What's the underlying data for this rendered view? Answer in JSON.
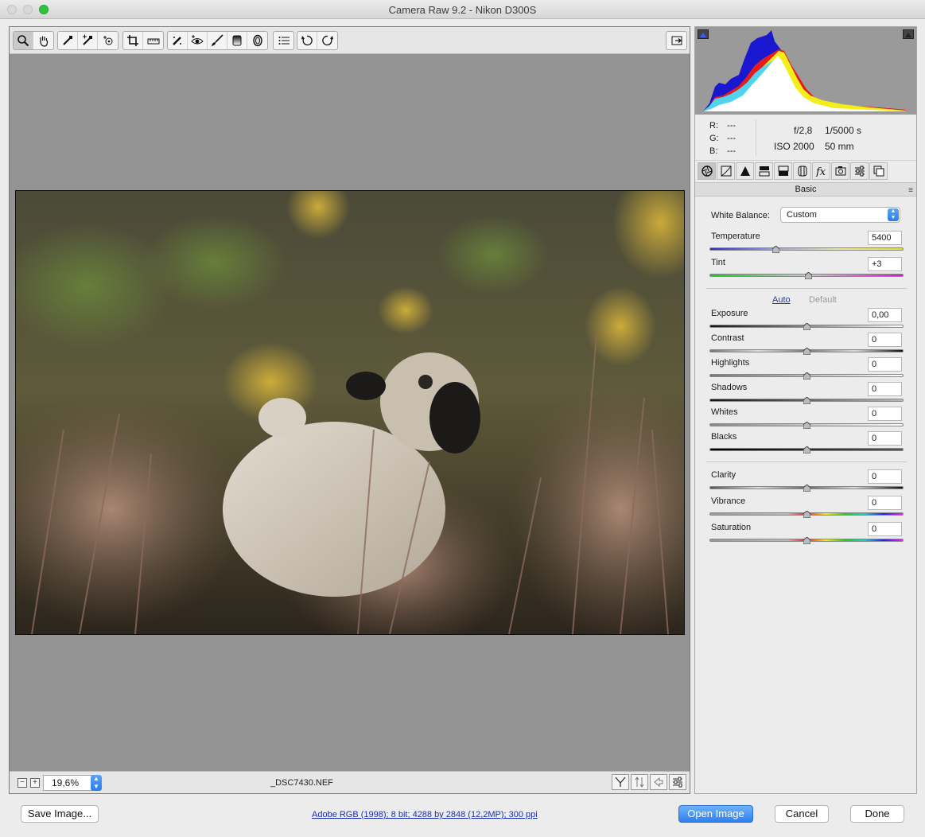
{
  "window": {
    "title": "Camera Raw 9.2  -  Nikon D300S"
  },
  "toolbar": {
    "tools": [
      "zoom-icon",
      "hand-icon",
      "white-balance-icon",
      "color-sampler-icon",
      "targeted-adjustment-icon",
      "crop-icon",
      "straighten-icon",
      "spot-removal-icon",
      "red-eye-icon",
      "adjustment-brush-icon",
      "graduated-filter-icon",
      "radial-filter-icon",
      "preferences-icon",
      "rotate-ccw-icon",
      "rotate-cw-icon"
    ],
    "fullscreen": "fullscreen-icon"
  },
  "status": {
    "zoom_minus": "−",
    "zoom_plus": "+",
    "zoom_value": "19,6%",
    "filename": "_DSC7430.NEF"
  },
  "histogram": {
    "readout": {
      "r_label": "R:",
      "g_label": "G:",
      "b_label": "B:",
      "r": "---",
      "g": "---",
      "b": "---"
    },
    "aperture": "f/2,8",
    "shutter": "1/5000 s",
    "iso": "ISO 2000",
    "focal": "50 mm"
  },
  "panel": {
    "section_title": "Basic",
    "white_balance_label": "White Balance:",
    "white_balance_value": "Custom",
    "auto_label": "Auto",
    "default_label": "Default",
    "sliders": {
      "temperature": {
        "label": "Temperature",
        "value": "5400",
        "pos": 0.34
      },
      "tint": {
        "label": "Tint",
        "value": "+3",
        "pos": 0.51
      },
      "exposure": {
        "label": "Exposure",
        "value": "0,00",
        "pos": 0.5
      },
      "contrast": {
        "label": "Contrast",
        "value": "0",
        "pos": 0.5
      },
      "highlights": {
        "label": "Highlights",
        "value": "0",
        "pos": 0.5
      },
      "shadows": {
        "label": "Shadows",
        "value": "0",
        "pos": 0.5
      },
      "whites": {
        "label": "Whites",
        "value": "0",
        "pos": 0.5
      },
      "blacks": {
        "label": "Blacks",
        "value": "0",
        "pos": 0.5
      },
      "clarity": {
        "label": "Clarity",
        "value": "0",
        "pos": 0.5
      },
      "vibrance": {
        "label": "Vibrance",
        "value": "0",
        "pos": 0.5
      },
      "saturation": {
        "label": "Saturation",
        "value": "0",
        "pos": 0.5
      }
    }
  },
  "footer": {
    "save_label": "Save Image...",
    "workflow_link": "Adobe RGB (1998); 8 bit; 4288 by 2848 (12,2MP); 300 ppi",
    "open_label": "Open Image",
    "cancel_label": "Cancel",
    "done_label": "Done"
  },
  "colors": {
    "accent": "#2f7ff0",
    "link": "#1b2fa7"
  }
}
